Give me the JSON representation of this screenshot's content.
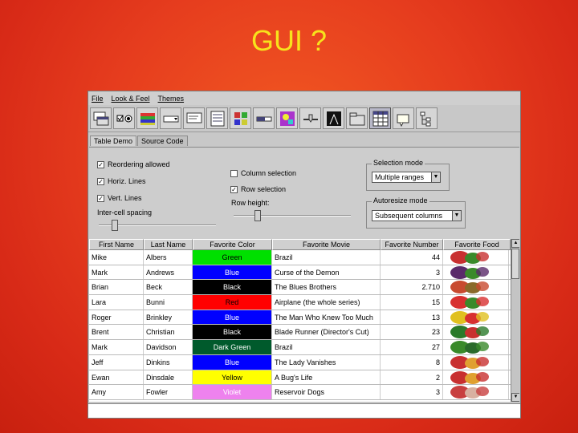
{
  "slide": {
    "title": "GUI ?"
  },
  "menu": [
    "File",
    "Look & Feel",
    "Themes"
  ],
  "toolbar": {
    "icons": [
      "internal-frame-icon",
      "checkbox-icon",
      "color-chooser-icon",
      "combobox-icon",
      "file-chooser-icon",
      "list-icon",
      "option-pane-icon",
      "progress-bar-icon",
      "scrollpane-icon",
      "slider-icon",
      "splitpane-icon",
      "tabbed-pane-icon",
      "table-icon",
      "tooltip-icon",
      "tree-icon"
    ],
    "selected_index": 12
  },
  "tabs": {
    "demo": "Table Demo",
    "source": "Source Code"
  },
  "options": {
    "reordering": "Reordering allowed",
    "horiz_lines": "Horiz. Lines",
    "vert_lines": "Vert. Lines",
    "intercell": "Inter-cell spacing",
    "column_selection": "Column selection",
    "row_selection": "Row selection",
    "row_height": "Row height:",
    "selection_mode_title": "Selection mode",
    "selection_mode_value": "Multiple ranges",
    "autoresize_title": "Autoresize mode",
    "autoresize_value": "Subsequent columns"
  },
  "table": {
    "headers": [
      "First Name",
      "Last Name",
      "Favorite Color",
      "Favorite Movie",
      "Favorite Number",
      "Favorite Food"
    ],
    "rows": [
      {
        "first": "Mike",
        "last": "Albers",
        "color": "Green",
        "color_hex": "#00e000",
        "text_hex": "#000000",
        "movie": "Brazil",
        "number": "44"
      },
      {
        "first": "Mark",
        "last": "Andrews",
        "color": "Blue",
        "color_hex": "#0000ff",
        "text_hex": "#ffffff",
        "movie": "Curse of the Demon",
        "number": "3"
      },
      {
        "first": "Brian",
        "last": "Beck",
        "color": "Black",
        "color_hex": "#000000",
        "text_hex": "#ffffff",
        "movie": "The Blues Brothers",
        "number": "2.710"
      },
      {
        "first": "Lara",
        "last": "Bunni",
        "color": "Red",
        "color_hex": "#ff0000",
        "text_hex": "#000000",
        "movie": "Airplane (the whole series)",
        "number": "15"
      },
      {
        "first": "Roger",
        "last": "Brinkley",
        "color": "Blue",
        "color_hex": "#0000ff",
        "text_hex": "#ffffff",
        "movie": "The Man Who Knew Too Much",
        "number": "13"
      },
      {
        "first": "Brent",
        "last": "Christian",
        "color": "Black",
        "color_hex": "#000000",
        "text_hex": "#ffffff",
        "movie": "Blade Runner (Director's Cut)",
        "number": "23"
      },
      {
        "first": "Mark",
        "last": "Davidson",
        "color": "Dark Green",
        "color_hex": "#005a2c",
        "text_hex": "#ffffff",
        "movie": "Brazil",
        "number": "27"
      },
      {
        "first": "Jeff",
        "last": "Dinkins",
        "color": "Blue",
        "color_hex": "#0000ff",
        "text_hex": "#ffffff",
        "movie": "The Lady Vanishes",
        "number": "8"
      },
      {
        "first": "Ewan",
        "last": "Dinsdale",
        "color": "Yellow",
        "color_hex": "#ffff00",
        "text_hex": "#000000",
        "movie": "A Bug's Life",
        "number": "2"
      },
      {
        "first": "Amy",
        "last": "Fowler",
        "color": "Violet",
        "color_hex": "#ee82ee",
        "text_hex": "#ffffff",
        "movie": "Reservoir Dogs",
        "number": "3"
      }
    ]
  }
}
